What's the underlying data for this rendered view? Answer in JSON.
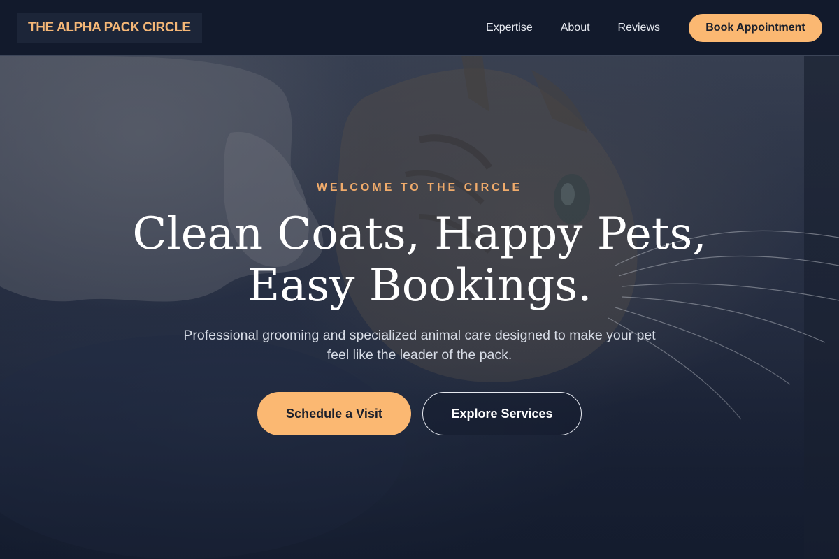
{
  "header": {
    "logo_text": "THE ALPHA PACK CIRCLE",
    "nav": [
      {
        "label": "Expertise"
      },
      {
        "label": "About"
      },
      {
        "label": "Reviews"
      }
    ],
    "cta_label": "Book Appointment"
  },
  "hero": {
    "eyebrow": "WELCOME TO THE CIRCLE",
    "headline_line1": "Clean Coats, Happy Pets,",
    "headline_line2": "Easy Bookings.",
    "subtitle": "Professional grooming and specialized animal care designed to make your pet feel like the leader of the pack.",
    "primary_button": "Schedule a Visit",
    "secondary_button": "Explore Services",
    "background_image": "cat-photo"
  },
  "colors": {
    "accent": "#fbb872",
    "eyebrow": "#f0ab6b",
    "header_bg": "#121a2c",
    "page_bg": "#141c2e"
  }
}
